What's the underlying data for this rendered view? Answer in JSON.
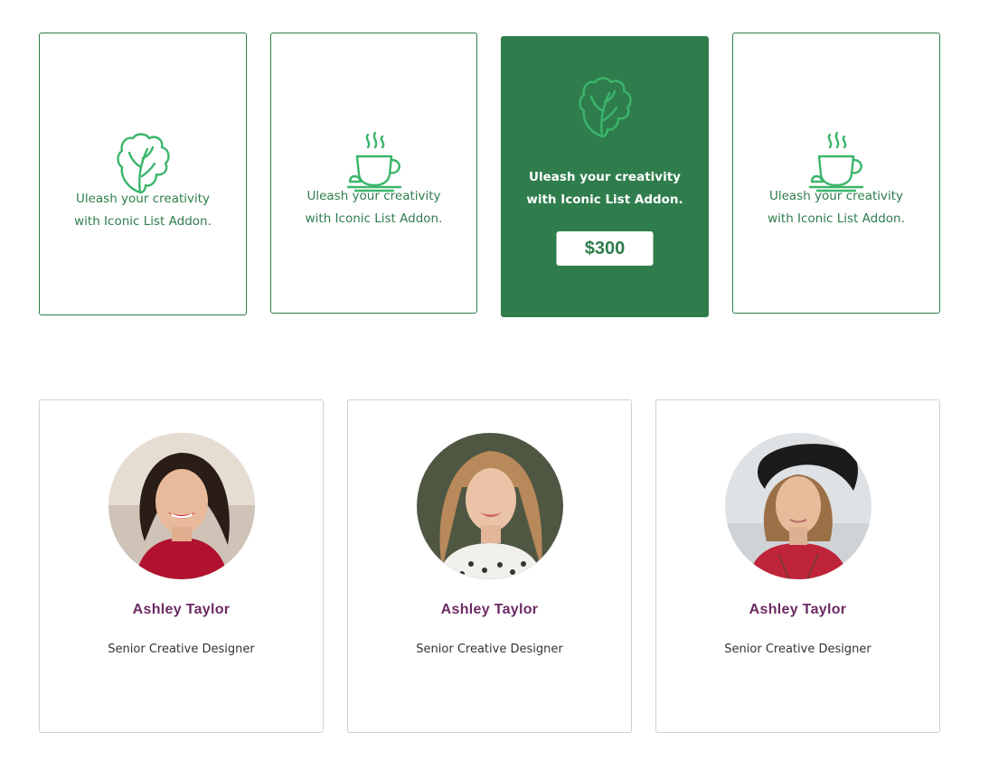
{
  "colors": {
    "accent": "#2f7d4c",
    "icon": "#3bb56a",
    "name": "#6b2a63",
    "role": "#333333"
  },
  "feature_cards": [
    {
      "icon": "lettuce-icon",
      "text_line1": "Uleash your creativity",
      "text_line2": "with Iconic List Addon."
    },
    {
      "icon": "coffee-cup-icon",
      "text_line1": "Uleash your creativity",
      "text_line2": "with Iconic List Addon."
    },
    {
      "icon": "lettuce-icon",
      "text_line1": "Uleash your creativity",
      "text_line2": "with Iconic List Addon.",
      "price": "$300",
      "active": true
    },
    {
      "icon": "coffee-cup-icon",
      "text_line1": "Uleash your creativity",
      "text_line2": "with Iconic List Addon."
    }
  ],
  "team": [
    {
      "name": "Ashley Taylor",
      "role": "Senior Creative Designer"
    },
    {
      "name": "Ashley Taylor",
      "role": "Senior Creative Designer"
    },
    {
      "name": "Ashley Taylor",
      "role": "Senior Creative Designer"
    }
  ]
}
